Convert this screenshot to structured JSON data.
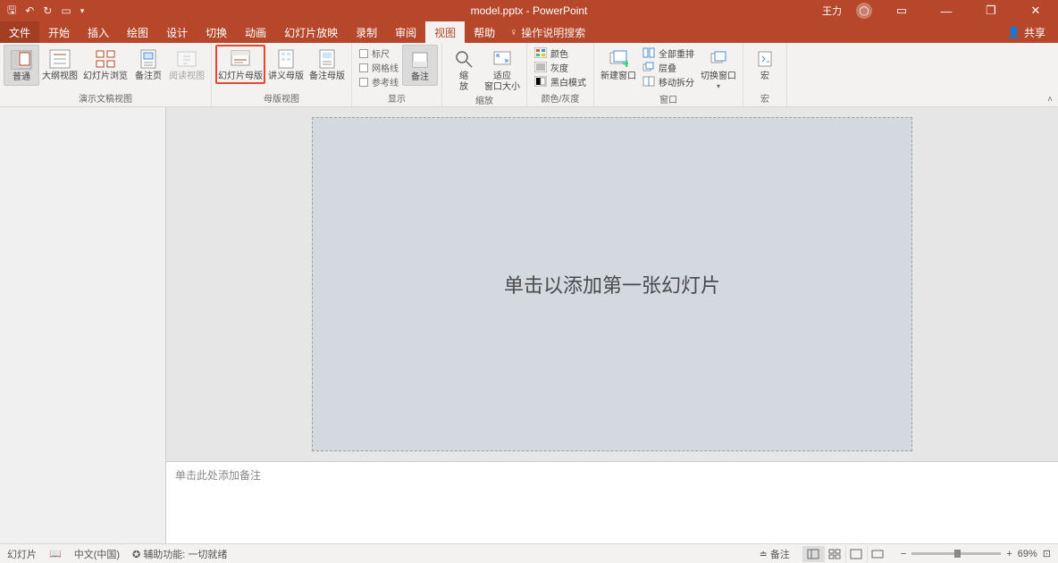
{
  "title": "model.pptx - PowerPoint",
  "user": "王力",
  "share": "共享",
  "tabs": {
    "file": "文件",
    "items": [
      "开始",
      "插入",
      "绘图",
      "设计",
      "切换",
      "动画",
      "幻灯片放映",
      "录制",
      "审阅",
      "视图",
      "帮助"
    ],
    "active_index": 9,
    "tell_me": "操作说明搜索"
  },
  "ribbon": {
    "presentation_views": {
      "label": "演示文稿视图",
      "normal": "普通",
      "outline": "大纲视图",
      "sorter": "幻灯片浏览",
      "notes_page": "备注页",
      "reading": "阅读视图"
    },
    "master_views": {
      "label": "母版视图",
      "slide_master": "幻灯片母版",
      "handout_master": "讲义母版",
      "notes_master": "备注母版"
    },
    "show": {
      "label": "显示",
      "ruler": "标尺",
      "gridlines": "网格线",
      "guides": "参考线",
      "notes": "备注"
    },
    "zoom": {
      "label": "缩放",
      "zoom": "缩\n放",
      "fit": "适应\n窗口大小"
    },
    "color": {
      "label": "颜色/灰度",
      "color": "颜色",
      "grayscale": "灰度",
      "bw": "黑白模式"
    },
    "window": {
      "label": "窗口",
      "new": "新建窗口",
      "arrange": "全部重排",
      "cascade": "层叠",
      "split": "移动拆分",
      "switch": "切换窗口"
    },
    "macros": {
      "label": "宏",
      "macros": "宏"
    }
  },
  "slide_placeholder": "单击以添加第一张幻灯片",
  "notes_placeholder": "单击此处添加备注",
  "status": {
    "slide": "幻灯片",
    "lang": "中文(中国)",
    "a11y": "辅助功能: 一切就绪",
    "notes_btn": "备注",
    "zoom_pct": "69%"
  }
}
